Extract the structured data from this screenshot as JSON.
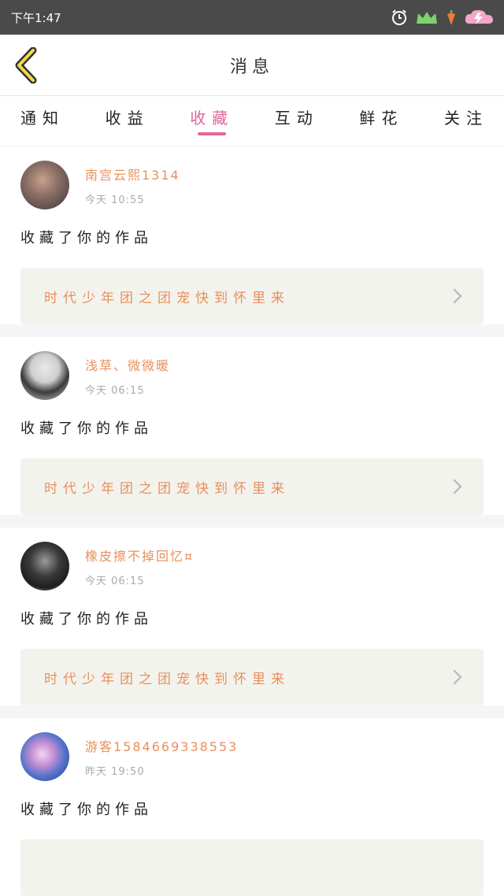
{
  "status_bar": {
    "time": "下午1:47"
  },
  "navbar": {
    "title": "消息"
  },
  "tabs": [
    {
      "label": "通知"
    },
    {
      "label": "收益"
    },
    {
      "label": "收藏"
    },
    {
      "label": "互动"
    },
    {
      "label": "鲜花"
    },
    {
      "label": "关注"
    }
  ],
  "active_tab": "收藏",
  "colors": {
    "accent": "#e0679a",
    "name": "#e8905c",
    "work_bg": "#f3f3ee",
    "status_bar": "#4a4a4a"
  },
  "items": [
    {
      "name": "南宫云熙1314",
      "time": "今天 10:55",
      "action": "收藏了你的作品",
      "work": "时代少年团之团宠快到怀里来"
    },
    {
      "name": "浅草、微微暖",
      "time": "今天 06:15",
      "action": "收藏了你的作品",
      "work": "时代少年团之团宠快到怀里来"
    },
    {
      "name": "橡皮擦不掉回忆¤",
      "time": "今天 06:15",
      "action": "收藏了你的作品",
      "work": "时代少年团之团宠快到怀里来"
    },
    {
      "name": "游客1584669338553",
      "time": "昨天 19:50",
      "action": "收藏了你的作品",
      "work": ""
    }
  ]
}
